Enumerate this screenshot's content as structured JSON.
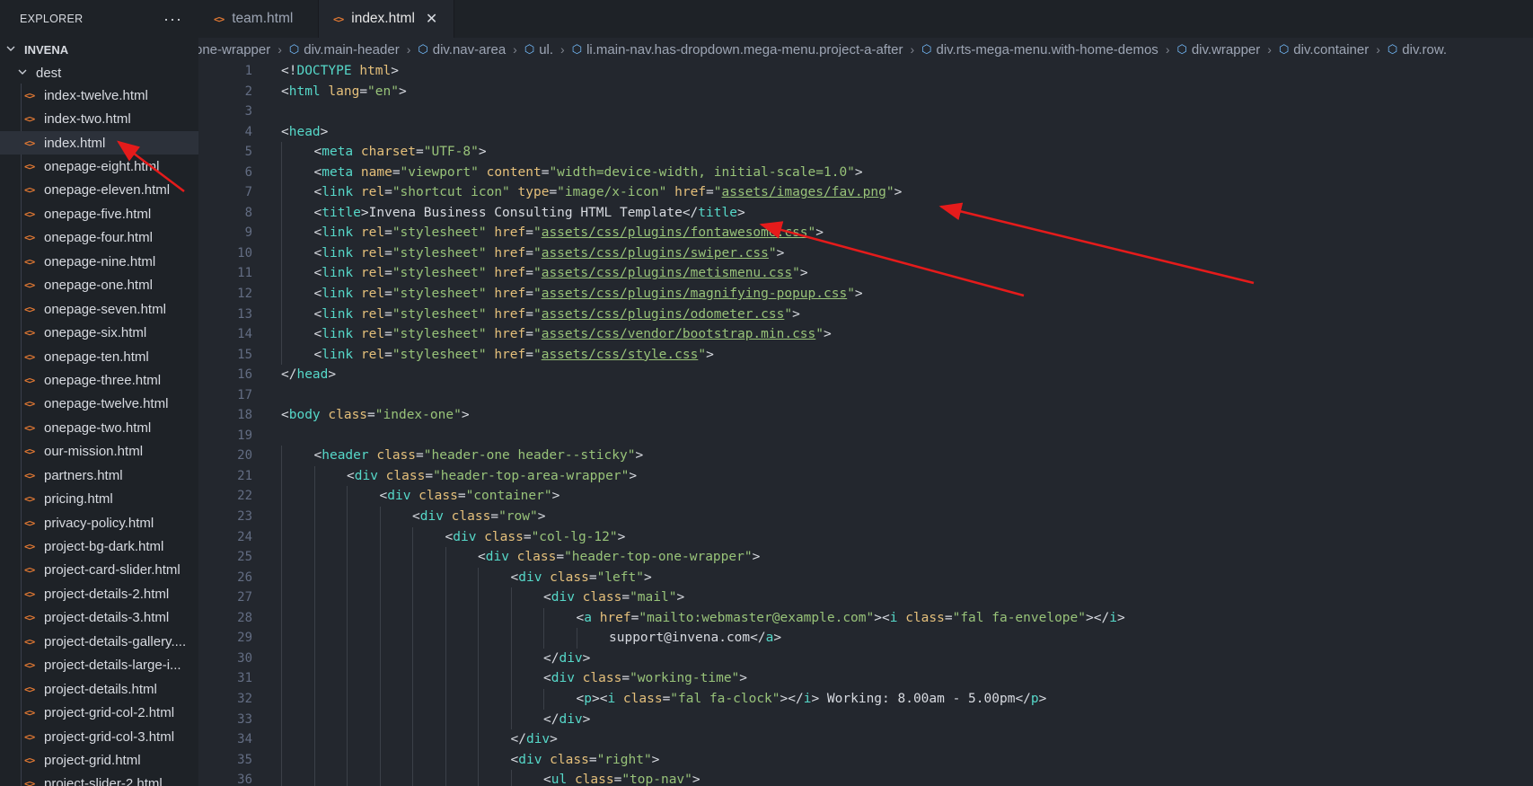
{
  "sidebar": {
    "title": "EXPLORER",
    "more": "···",
    "root": "INVENA",
    "folder": "dest",
    "files": [
      "index-twelve.html",
      "index-two.html",
      "index.html",
      "onepage-eight.html",
      "onepage-eleven.html",
      "onepage-five.html",
      "onepage-four.html",
      "onepage-nine.html",
      "onepage-one.html",
      "onepage-seven.html",
      "onepage-six.html",
      "onepage-ten.html",
      "onepage-three.html",
      "onepage-twelve.html",
      "onepage-two.html",
      "our-mission.html",
      "partners.html",
      "pricing.html",
      "privacy-policy.html",
      "project-bg-dark.html",
      "project-card-slider.html",
      "project-details-2.html",
      "project-details-3.html",
      "project-details-gallery....",
      "project-details-large-i...",
      "project-details.html",
      "project-grid-col-2.html",
      "project-grid-col-3.html",
      "project-grid.html",
      "project-slider-2.html"
    ],
    "selected_file": "index.html"
  },
  "tabs": [
    {
      "label": "team.html",
      "active": false
    },
    {
      "label": "index.html",
      "active": true,
      "close": "✕"
    }
  ],
  "breadcrumb": [
    "one-wrapper",
    "div.main-header",
    "div.nav-area",
    "ul.",
    "li.main-nav.has-dropdown.mega-menu.project-a-after",
    "div.rts-mega-menu.with-home-demos",
    "div.wrapper",
    "div.container",
    "div.row."
  ],
  "code_lines": [
    {
      "n": "1",
      "indent": 0,
      "tokens": [
        [
          "p",
          "<!"
        ],
        [
          "t",
          "DOCTYPE"
        ],
        [
          "x",
          " "
        ],
        [
          "a",
          "html"
        ],
        [
          "p",
          ">"
        ]
      ]
    },
    {
      "n": "2",
      "indent": 0,
      "tokens": [
        [
          "p",
          "<"
        ],
        [
          "t",
          "html"
        ],
        [
          "x",
          " "
        ],
        [
          "a",
          "lang"
        ],
        [
          "p",
          "="
        ],
        [
          "s",
          "\"en\""
        ],
        [
          "p",
          ">"
        ]
      ]
    },
    {
      "n": "3",
      "indent": 0,
      "tokens": []
    },
    {
      "n": "4",
      "indent": 0,
      "tokens": [
        [
          "p",
          "<"
        ],
        [
          "t",
          "head"
        ],
        [
          "p",
          ">"
        ]
      ]
    },
    {
      "n": "5",
      "indent": 1,
      "tokens": [
        [
          "p",
          "<"
        ],
        [
          "t",
          "meta"
        ],
        [
          "x",
          " "
        ],
        [
          "a",
          "charset"
        ],
        [
          "p",
          "="
        ],
        [
          "s",
          "\"UTF-8\""
        ],
        [
          "p",
          ">"
        ]
      ]
    },
    {
      "n": "6",
      "indent": 1,
      "tokens": [
        [
          "p",
          "<"
        ],
        [
          "t",
          "meta"
        ],
        [
          "x",
          " "
        ],
        [
          "a",
          "name"
        ],
        [
          "p",
          "="
        ],
        [
          "s",
          "\"viewport\""
        ],
        [
          "x",
          " "
        ],
        [
          "a",
          "content"
        ],
        [
          "p",
          "="
        ],
        [
          "s",
          "\"width=device-width, initial-scale=1.0\""
        ],
        [
          "p",
          ">"
        ]
      ]
    },
    {
      "n": "7",
      "indent": 1,
      "tokens": [
        [
          "p",
          "<"
        ],
        [
          "t",
          "link"
        ],
        [
          "x",
          " "
        ],
        [
          "a",
          "rel"
        ],
        [
          "p",
          "="
        ],
        [
          "s",
          "\"shortcut icon\""
        ],
        [
          "x",
          " "
        ],
        [
          "a",
          "type"
        ],
        [
          "p",
          "="
        ],
        [
          "s",
          "\"image/x-icon\""
        ],
        [
          "x",
          " "
        ],
        [
          "a",
          "href"
        ],
        [
          "p",
          "="
        ],
        [
          "s",
          "\""
        ],
        [
          "l",
          "assets/images/fav.png"
        ],
        [
          "s",
          "\""
        ],
        [
          "p",
          ">"
        ]
      ]
    },
    {
      "n": "8",
      "indent": 1,
      "tokens": [
        [
          "p",
          "<"
        ],
        [
          "t",
          "title"
        ],
        [
          "p",
          ">"
        ],
        [
          "x",
          "Invena Business Consulting HTML Template"
        ],
        [
          "p",
          "</"
        ],
        [
          "t",
          "title"
        ],
        [
          "p",
          ">"
        ]
      ]
    },
    {
      "n": "9",
      "indent": 1,
      "tokens": [
        [
          "p",
          "<"
        ],
        [
          "t",
          "link"
        ],
        [
          "x",
          " "
        ],
        [
          "a",
          "rel"
        ],
        [
          "p",
          "="
        ],
        [
          "s",
          "\"stylesheet\""
        ],
        [
          "x",
          " "
        ],
        [
          "a",
          "href"
        ],
        [
          "p",
          "="
        ],
        [
          "s",
          "\""
        ],
        [
          "l",
          "assets/css/plugins/fontawesome.css"
        ],
        [
          "s",
          "\""
        ],
        [
          "p",
          ">"
        ]
      ]
    },
    {
      "n": "10",
      "indent": 1,
      "tokens": [
        [
          "p",
          "<"
        ],
        [
          "t",
          "link"
        ],
        [
          "x",
          " "
        ],
        [
          "a",
          "rel"
        ],
        [
          "p",
          "="
        ],
        [
          "s",
          "\"stylesheet\""
        ],
        [
          "x",
          " "
        ],
        [
          "a",
          "href"
        ],
        [
          "p",
          "="
        ],
        [
          "s",
          "\""
        ],
        [
          "l",
          "assets/css/plugins/swiper.css"
        ],
        [
          "s",
          "\""
        ],
        [
          "p",
          ">"
        ]
      ]
    },
    {
      "n": "11",
      "indent": 1,
      "tokens": [
        [
          "p",
          "<"
        ],
        [
          "t",
          "link"
        ],
        [
          "x",
          " "
        ],
        [
          "a",
          "rel"
        ],
        [
          "p",
          "="
        ],
        [
          "s",
          "\"stylesheet\""
        ],
        [
          "x",
          " "
        ],
        [
          "a",
          "href"
        ],
        [
          "p",
          "="
        ],
        [
          "s",
          "\""
        ],
        [
          "l",
          "assets/css/plugins/metismenu.css"
        ],
        [
          "s",
          "\""
        ],
        [
          "p",
          ">"
        ]
      ]
    },
    {
      "n": "12",
      "indent": 1,
      "tokens": [
        [
          "p",
          "<"
        ],
        [
          "t",
          "link"
        ],
        [
          "x",
          " "
        ],
        [
          "a",
          "rel"
        ],
        [
          "p",
          "="
        ],
        [
          "s",
          "\"stylesheet\""
        ],
        [
          "x",
          " "
        ],
        [
          "a",
          "href"
        ],
        [
          "p",
          "="
        ],
        [
          "s",
          "\""
        ],
        [
          "l",
          "assets/css/plugins/magnifying-popup.css"
        ],
        [
          "s",
          "\""
        ],
        [
          "p",
          ">"
        ]
      ]
    },
    {
      "n": "13",
      "indent": 1,
      "tokens": [
        [
          "p",
          "<"
        ],
        [
          "t",
          "link"
        ],
        [
          "x",
          " "
        ],
        [
          "a",
          "rel"
        ],
        [
          "p",
          "="
        ],
        [
          "s",
          "\"stylesheet\""
        ],
        [
          "x",
          " "
        ],
        [
          "a",
          "href"
        ],
        [
          "p",
          "="
        ],
        [
          "s",
          "\""
        ],
        [
          "l",
          "assets/css/plugins/odometer.css"
        ],
        [
          "s",
          "\""
        ],
        [
          "p",
          ">"
        ]
      ]
    },
    {
      "n": "14",
      "indent": 1,
      "tokens": [
        [
          "p",
          "<"
        ],
        [
          "t",
          "link"
        ],
        [
          "x",
          " "
        ],
        [
          "a",
          "rel"
        ],
        [
          "p",
          "="
        ],
        [
          "s",
          "\"stylesheet\""
        ],
        [
          "x",
          " "
        ],
        [
          "a",
          "href"
        ],
        [
          "p",
          "="
        ],
        [
          "s",
          "\""
        ],
        [
          "l",
          "assets/css/vendor/bootstrap.min.css"
        ],
        [
          "s",
          "\""
        ],
        [
          "p",
          ">"
        ]
      ]
    },
    {
      "n": "15",
      "indent": 1,
      "tokens": [
        [
          "p",
          "<"
        ],
        [
          "t",
          "link"
        ],
        [
          "x",
          " "
        ],
        [
          "a",
          "rel"
        ],
        [
          "p",
          "="
        ],
        [
          "s",
          "\"stylesheet\""
        ],
        [
          "x",
          " "
        ],
        [
          "a",
          "href"
        ],
        [
          "p",
          "="
        ],
        [
          "s",
          "\""
        ],
        [
          "l",
          "assets/css/style.css"
        ],
        [
          "s",
          "\""
        ],
        [
          "p",
          ">"
        ]
      ]
    },
    {
      "n": "16",
      "indent": 0,
      "tokens": [
        [
          "p",
          "</"
        ],
        [
          "t",
          "head"
        ],
        [
          "p",
          ">"
        ]
      ]
    },
    {
      "n": "17",
      "indent": 0,
      "tokens": []
    },
    {
      "n": "18",
      "indent": 0,
      "tokens": [
        [
          "p",
          "<"
        ],
        [
          "t",
          "body"
        ],
        [
          "x",
          " "
        ],
        [
          "a",
          "class"
        ],
        [
          "p",
          "="
        ],
        [
          "s",
          "\"index-one\""
        ],
        [
          "p",
          ">"
        ]
      ]
    },
    {
      "n": "19",
      "indent": 0,
      "tokens": []
    },
    {
      "n": "20",
      "indent": 1,
      "tokens": [
        [
          "p",
          "<"
        ],
        [
          "t",
          "header"
        ],
        [
          "x",
          " "
        ],
        [
          "a",
          "class"
        ],
        [
          "p",
          "="
        ],
        [
          "s",
          "\"header-one header--sticky\""
        ],
        [
          "p",
          ">"
        ]
      ]
    },
    {
      "n": "21",
      "indent": 2,
      "tokens": [
        [
          "p",
          "<"
        ],
        [
          "t",
          "div"
        ],
        [
          "x",
          " "
        ],
        [
          "a",
          "class"
        ],
        [
          "p",
          "="
        ],
        [
          "s",
          "\"header-top-area-wrapper\""
        ],
        [
          "p",
          ">"
        ]
      ]
    },
    {
      "n": "22",
      "indent": 3,
      "tokens": [
        [
          "p",
          "<"
        ],
        [
          "t",
          "div"
        ],
        [
          "x",
          " "
        ],
        [
          "a",
          "class"
        ],
        [
          "p",
          "="
        ],
        [
          "s",
          "\"container\""
        ],
        [
          "p",
          ">"
        ]
      ]
    },
    {
      "n": "23",
      "indent": 4,
      "tokens": [
        [
          "p",
          "<"
        ],
        [
          "t",
          "div"
        ],
        [
          "x",
          " "
        ],
        [
          "a",
          "class"
        ],
        [
          "p",
          "="
        ],
        [
          "s",
          "\"row\""
        ],
        [
          "p",
          ">"
        ]
      ]
    },
    {
      "n": "24",
      "indent": 5,
      "tokens": [
        [
          "p",
          "<"
        ],
        [
          "t",
          "div"
        ],
        [
          "x",
          " "
        ],
        [
          "a",
          "class"
        ],
        [
          "p",
          "="
        ],
        [
          "s",
          "\"col-lg-12\""
        ],
        [
          "p",
          ">"
        ]
      ]
    },
    {
      "n": "25",
      "indent": 6,
      "tokens": [
        [
          "p",
          "<"
        ],
        [
          "t",
          "div"
        ],
        [
          "x",
          " "
        ],
        [
          "a",
          "class"
        ],
        [
          "p",
          "="
        ],
        [
          "s",
          "\"header-top-one-wrapper\""
        ],
        [
          "p",
          ">"
        ]
      ]
    },
    {
      "n": "26",
      "indent": 7,
      "tokens": [
        [
          "p",
          "<"
        ],
        [
          "t",
          "div"
        ],
        [
          "x",
          " "
        ],
        [
          "a",
          "class"
        ],
        [
          "p",
          "="
        ],
        [
          "s",
          "\"left\""
        ],
        [
          "p",
          ">"
        ]
      ]
    },
    {
      "n": "27",
      "indent": 8,
      "tokens": [
        [
          "p",
          "<"
        ],
        [
          "t",
          "div"
        ],
        [
          "x",
          " "
        ],
        [
          "a",
          "class"
        ],
        [
          "p",
          "="
        ],
        [
          "s",
          "\"mail\""
        ],
        [
          "p",
          ">"
        ]
      ]
    },
    {
      "n": "28",
      "indent": 9,
      "tokens": [
        [
          "p",
          "<"
        ],
        [
          "t",
          "a"
        ],
        [
          "x",
          " "
        ],
        [
          "a",
          "href"
        ],
        [
          "p",
          "="
        ],
        [
          "s",
          "\"mailto:webmaster@example.com\""
        ],
        [
          "p",
          "><"
        ],
        [
          "t",
          "i"
        ],
        [
          "x",
          " "
        ],
        [
          "a",
          "class"
        ],
        [
          "p",
          "="
        ],
        [
          "s",
          "\"fal fa-envelope\""
        ],
        [
          "p",
          "></"
        ],
        [
          "t",
          "i"
        ],
        [
          "p",
          ">"
        ]
      ]
    },
    {
      "n": "29",
      "indent": 10,
      "tokens": [
        [
          "x",
          "support@invena.com"
        ],
        [
          "p",
          "</"
        ],
        [
          "t",
          "a"
        ],
        [
          "p",
          ">"
        ]
      ]
    },
    {
      "n": "30",
      "indent": 8,
      "tokens": [
        [
          "p",
          "</"
        ],
        [
          "t",
          "div"
        ],
        [
          "p",
          ">"
        ]
      ]
    },
    {
      "n": "31",
      "indent": 8,
      "tokens": [
        [
          "p",
          "<"
        ],
        [
          "t",
          "div"
        ],
        [
          "x",
          " "
        ],
        [
          "a",
          "class"
        ],
        [
          "p",
          "="
        ],
        [
          "s",
          "\"working-time\""
        ],
        [
          "p",
          ">"
        ]
      ]
    },
    {
      "n": "32",
      "indent": 9,
      "tokens": [
        [
          "p",
          "<"
        ],
        [
          "t",
          "p"
        ],
        [
          "p",
          "><"
        ],
        [
          "t",
          "i"
        ],
        [
          "x",
          " "
        ],
        [
          "a",
          "class"
        ],
        [
          "p",
          "="
        ],
        [
          "s",
          "\"fal fa-clock\""
        ],
        [
          "p",
          "></"
        ],
        [
          "t",
          "i"
        ],
        [
          "p",
          ">"
        ],
        [
          "x",
          " Working: 8.00am - 5.00pm"
        ],
        [
          "p",
          "</"
        ],
        [
          "t",
          "p"
        ],
        [
          "p",
          ">"
        ]
      ]
    },
    {
      "n": "33",
      "indent": 8,
      "tokens": [
        [
          "p",
          "</"
        ],
        [
          "t",
          "div"
        ],
        [
          "p",
          ">"
        ]
      ]
    },
    {
      "n": "34",
      "indent": 7,
      "tokens": [
        [
          "p",
          "</"
        ],
        [
          "t",
          "div"
        ],
        [
          "p",
          ">"
        ]
      ]
    },
    {
      "n": "35",
      "indent": 7,
      "tokens": [
        [
          "p",
          "<"
        ],
        [
          "t",
          "div"
        ],
        [
          "x",
          " "
        ],
        [
          "a",
          "class"
        ],
        [
          "p",
          "="
        ],
        [
          "s",
          "\"right\""
        ],
        [
          "p",
          ">"
        ]
      ]
    },
    {
      "n": "36",
      "indent": 8,
      "tokens": [
        [
          "p",
          "<"
        ],
        [
          "t",
          "ul"
        ],
        [
          "x",
          " "
        ],
        [
          "a",
          "class"
        ],
        [
          "p",
          "="
        ],
        [
          "s",
          "\"top-nav\""
        ],
        [
          "p",
          ">"
        ]
      ]
    }
  ],
  "colors": {
    "editor_bg": "#23272e",
    "sidebar_bg": "#1e2227",
    "tag": "#56d8c9",
    "attr": "#e5c07b",
    "string": "#98c379",
    "annotation_arrow": "#e51b1b"
  }
}
